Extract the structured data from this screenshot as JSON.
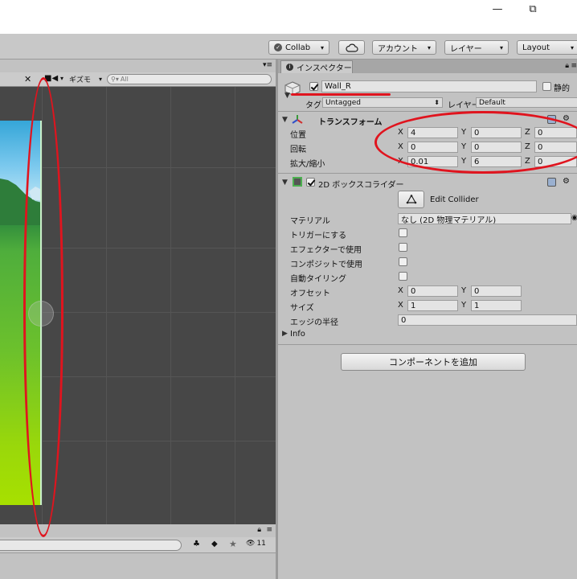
{
  "window": {
    "minimize_icon": "—",
    "restore_icon": "⧉"
  },
  "toolbar": {
    "collab_label": "Collab",
    "account_label": "アカウント",
    "layers_label": "レイヤー",
    "layout_label": "Layout"
  },
  "scene": {
    "gizmos_label": "ギズモ",
    "search_placeholder": "All"
  },
  "bottom_panel": {
    "hidden_count": "11"
  },
  "inspector": {
    "tab_label": "インスペクター",
    "object_name": "Wall_R",
    "static_label": "静的",
    "tag_label": "タグ",
    "tag_value": "Untagged",
    "layer_label": "レイヤー",
    "layer_value": "Default",
    "transform": {
      "title": "トランスフォーム",
      "position_label": "位置",
      "rotation_label": "回転",
      "scale_label": "拡大/縮小",
      "axis_x": "X",
      "axis_y": "Y",
      "axis_z": "Z",
      "position": {
        "x": "4",
        "y": "0",
        "z": "0"
      },
      "rotation": {
        "x": "0",
        "y": "0",
        "z": "0"
      },
      "scale": {
        "x": "0.01",
        "y": "6",
        "z": "0"
      }
    },
    "box_collider": {
      "title": "2D ボックスコライダー",
      "edit_collider_label": "Edit Collider",
      "material_label": "マテリアル",
      "material_value": "なし (2D 物理マテリアル)",
      "is_trigger_label": "トリガーにする",
      "used_by_effector_label": "エフェクターで使用",
      "used_by_composite_label": "コンポジットで使用",
      "auto_tiling_label": "自動タイリング",
      "offset_label": "オフセット",
      "offset": {
        "x": "0",
        "y": "0"
      },
      "size_label": "サイズ",
      "size": {
        "x": "1",
        "y": "1"
      },
      "edge_radius_label": "エッジの半径",
      "edge_radius_value": "0",
      "info_label": "Info"
    },
    "add_component_label": "コンポーネントを追加"
  },
  "colors": {
    "annotation_red": "#e0141e",
    "scene_bg": "#474747",
    "panel_bg": "#c2c2c2"
  }
}
